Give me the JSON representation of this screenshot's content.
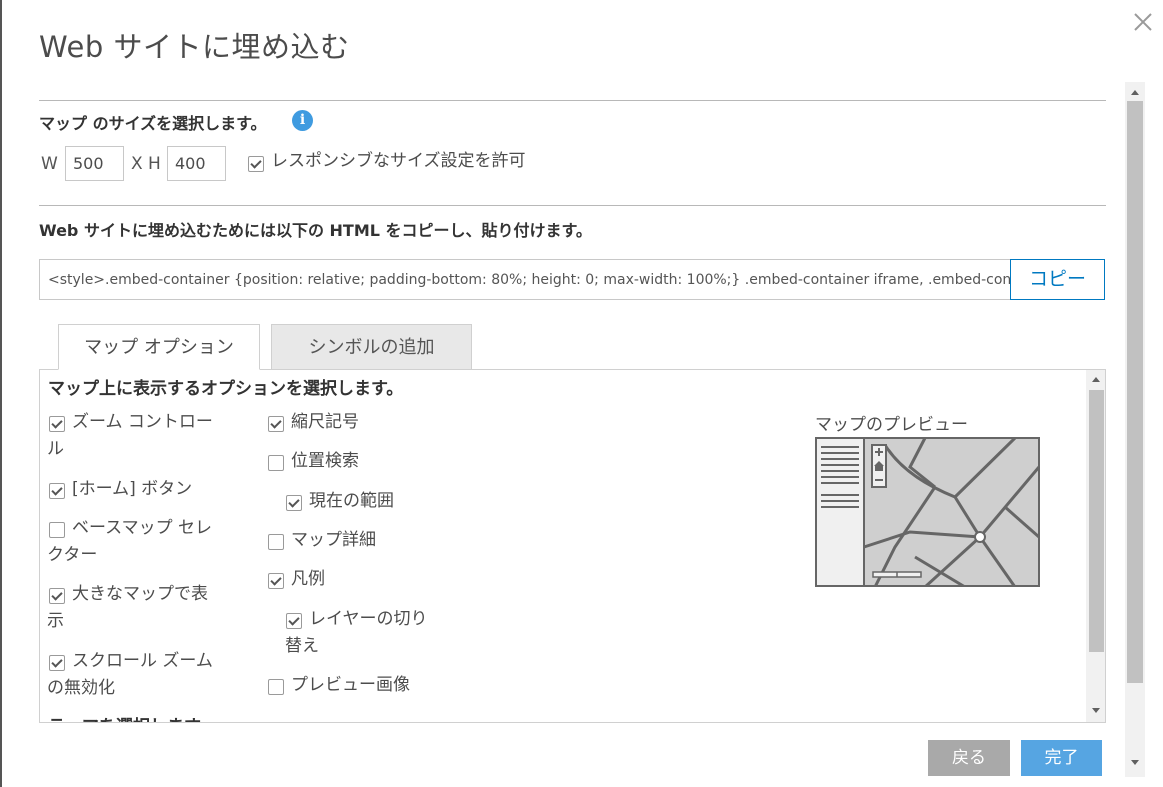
{
  "dialog": {
    "title": "Web サイトに埋め込む"
  },
  "size": {
    "label": "マップ のサイズを選択します。",
    "info_icon": "info-icon",
    "width_label": "W",
    "width_value": "500",
    "height_label": "X H",
    "height_value": "400",
    "responsive_label": "レスポンシブなサイズ設定を許可",
    "responsive_checked": true
  },
  "embed": {
    "label": "Web サイトに埋め込むためには以下の HTML をコピーし、貼り付けます。",
    "code": "<style>.embed-container {position: relative; padding-bottom: 80%; height: 0; max-width: 100%;} .embed-container iframe, .embed-container object, .embed-container iframe{position: absolute; top: 0; left: 0; width: 100%; height: 100%;}",
    "copy_label": "コピー"
  },
  "tabs": [
    {
      "label": "マップ オプション",
      "active": true
    },
    {
      "label": "シンボルの追加",
      "active": false
    }
  ],
  "options": {
    "title": "マップ上に表示するオプションを選択します。",
    "col1": [
      {
        "line1": "ズーム コントロー",
        "line2": "ル",
        "checked": true
      },
      {
        "line1": "[ホーム] ボタン",
        "line2": "",
        "checked": true
      },
      {
        "line1": "ベースマップ セレ",
        "line2": "クター",
        "checked": false
      },
      {
        "line1": "大きなマップで表",
        "line2": "示",
        "checked": true
      },
      {
        "line1": "スクロール ズーム",
        "line2": "の無効化",
        "checked": true
      }
    ],
    "col2": [
      {
        "line1": "縮尺記号",
        "line2": "",
        "checked": true
      },
      {
        "line1": "位置検索",
        "line2": "",
        "checked": false
      },
      {
        "line1": "現在の範囲",
        "line2": "",
        "checked": true
      },
      {
        "line1": "マップ詳細",
        "line2": "",
        "checked": false
      },
      {
        "line1": "凡例",
        "line2": "",
        "checked": true
      },
      {
        "line1": "レイヤーの切り",
        "line2": "替え",
        "checked": true
      },
      {
        "line1": "プレビュー画像",
        "line2": "",
        "checked": false
      }
    ],
    "cut_title": "テーマを選択します",
    "preview_label": "マップのプレビュー"
  },
  "footer": {
    "back_label": "戻る",
    "done_label": "完了"
  },
  "colors": {
    "accent": "#0079c1",
    "done_button": "#56a5e2",
    "back_button": "#a9a9a9",
    "info": "#3f9be0"
  }
}
